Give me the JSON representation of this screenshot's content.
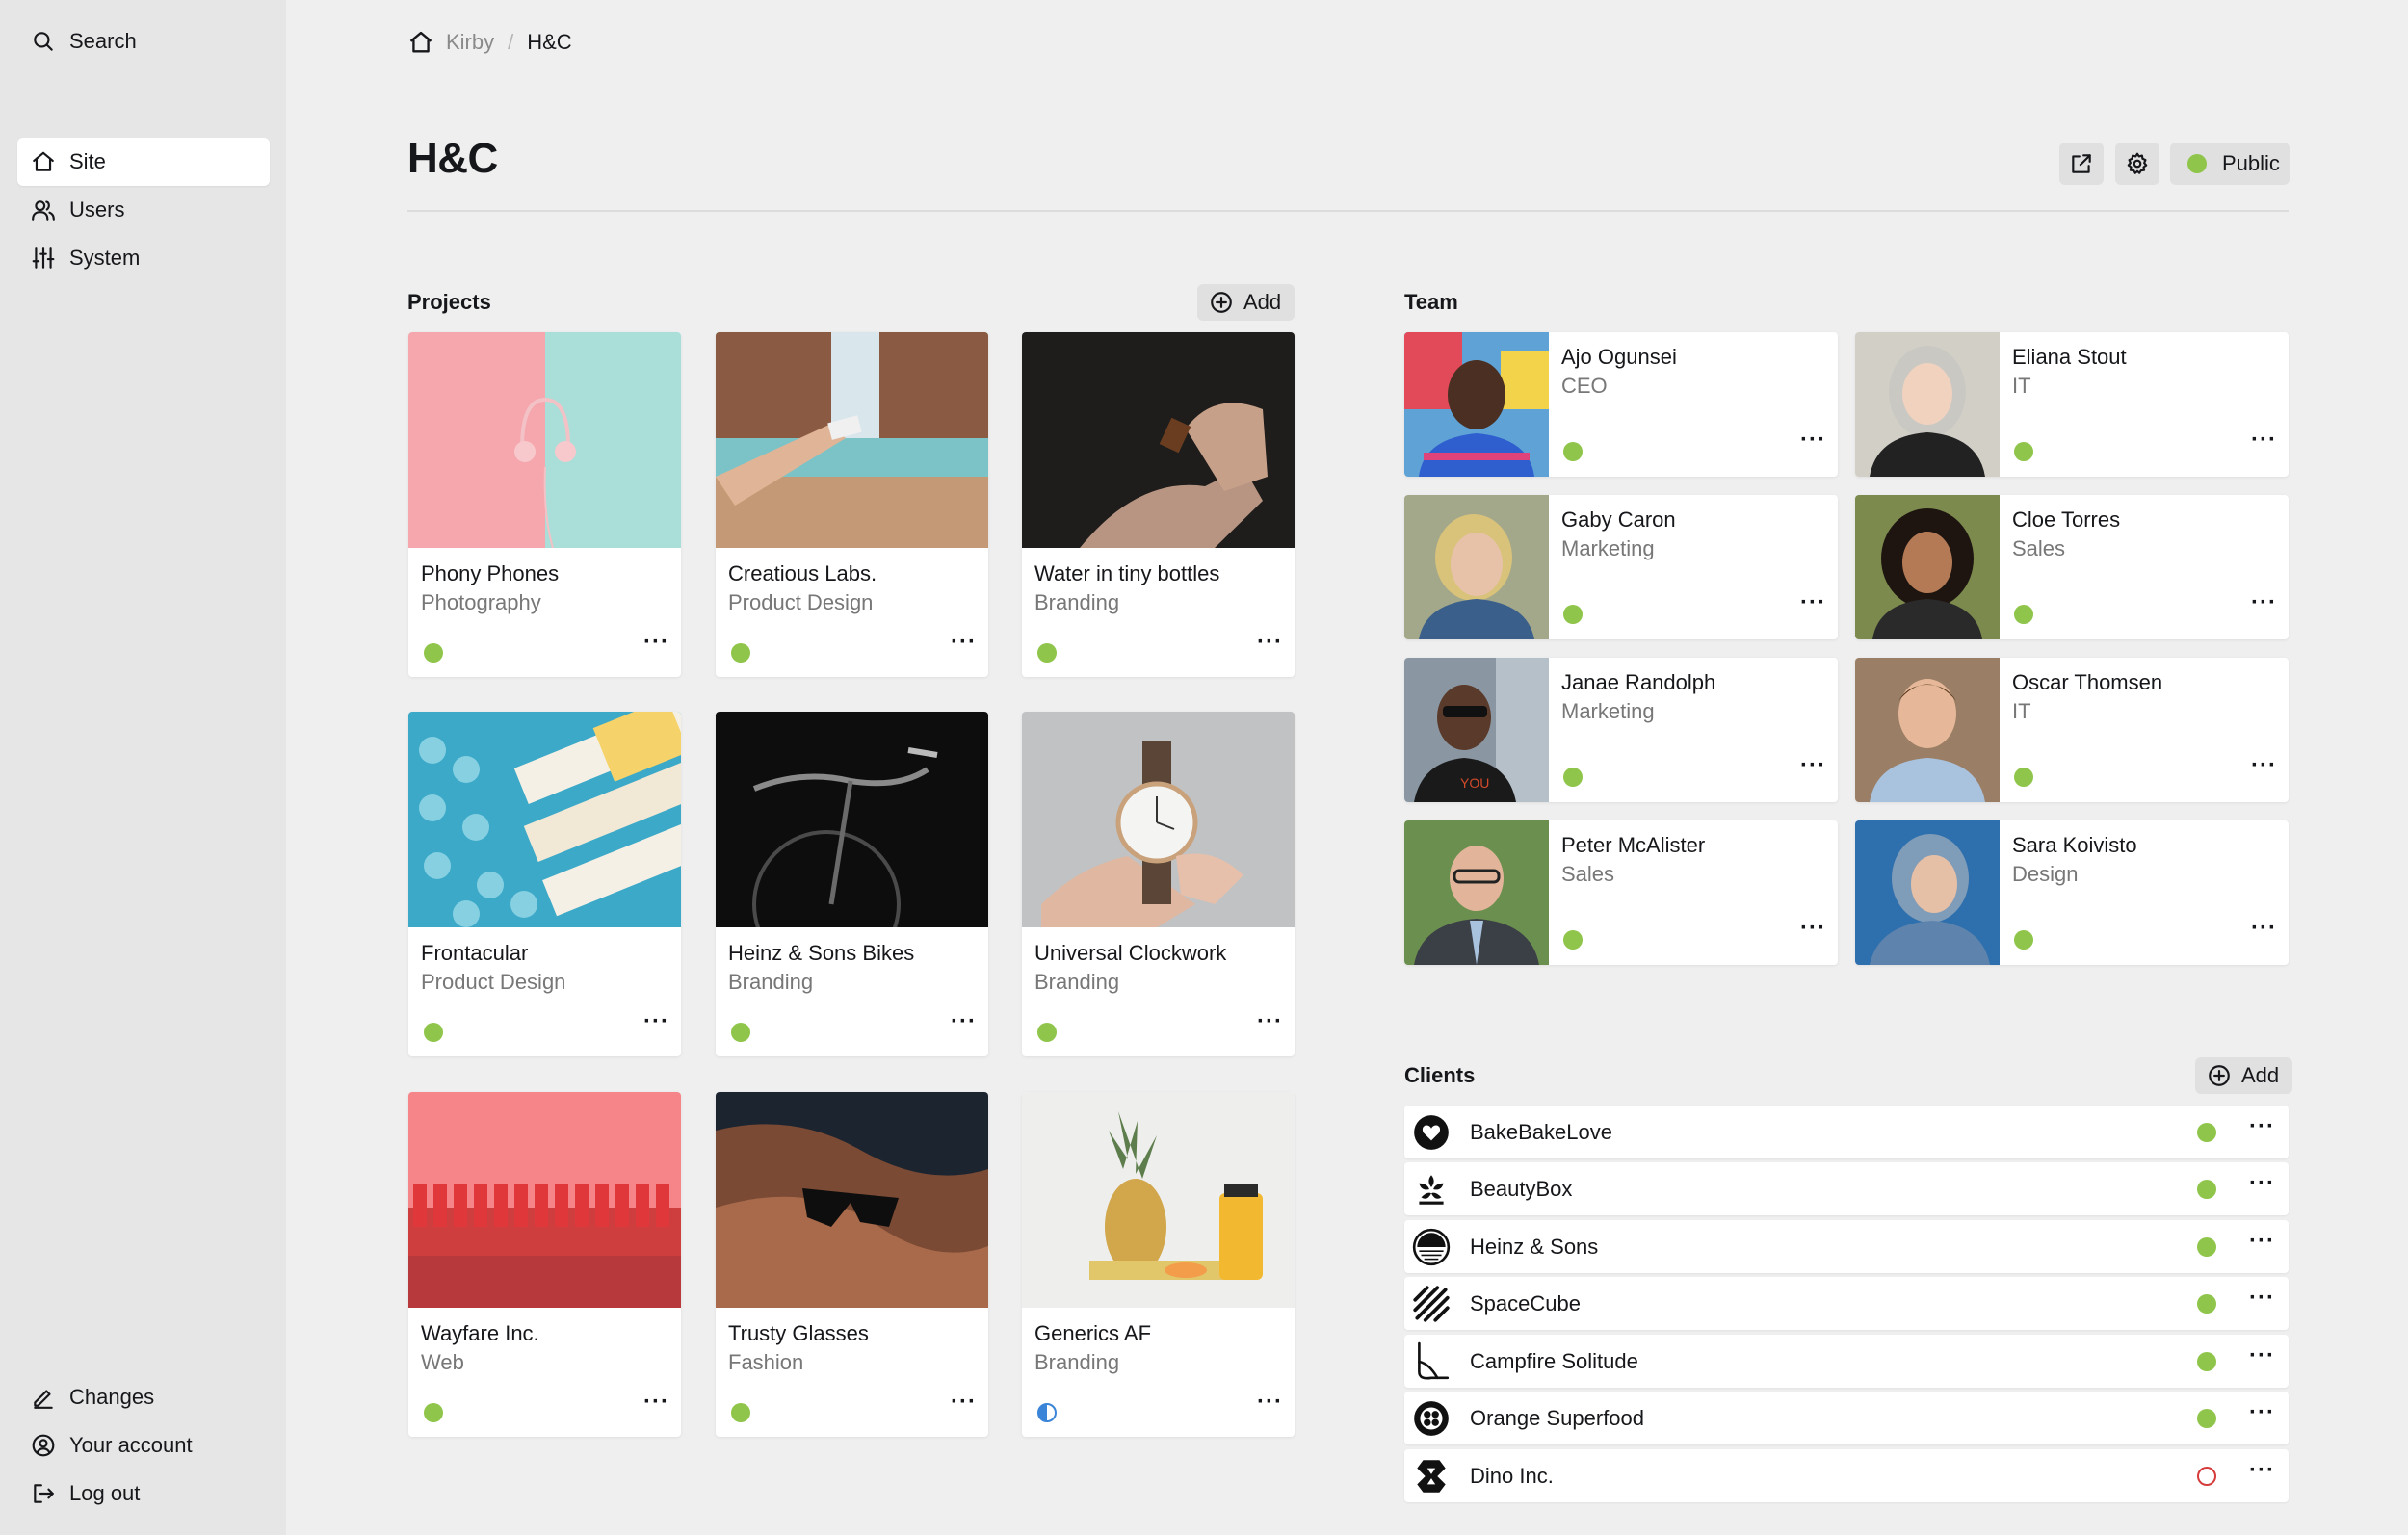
{
  "sidebar": {
    "search_label": "Search",
    "nav": [
      {
        "label": "Site",
        "icon": "home-icon"
      },
      {
        "label": "Users",
        "icon": "users-icon"
      },
      {
        "label": "System",
        "icon": "sliders-icon"
      }
    ],
    "bottom": [
      {
        "label": "Changes",
        "icon": "pencil-icon"
      },
      {
        "label": "Your account",
        "icon": "account-icon"
      },
      {
        "label": "Log out",
        "icon": "logout-icon"
      }
    ]
  },
  "breadcrumb": {
    "root": "Kirby",
    "separator": "/",
    "current": "H&C"
  },
  "page": {
    "title": "H&C",
    "status_label": "Public",
    "status": "published"
  },
  "projects": {
    "label": "Projects",
    "add_label": "Add",
    "items": [
      {
        "title": "Phony Phones",
        "category": "Photography",
        "status": "published"
      },
      {
        "title": "Creatious Labs.",
        "category": "Product Design",
        "status": "published"
      },
      {
        "title": "Water in tiny bottles",
        "category": "Branding",
        "status": "published"
      },
      {
        "title": "Frontacular",
        "category": "Product Design",
        "status": "published"
      },
      {
        "title": "Heinz & Sons Bikes",
        "category": "Branding",
        "status": "published"
      },
      {
        "title": "Universal Clockwork",
        "category": "Branding",
        "status": "published"
      },
      {
        "title": "Wayfare Inc.",
        "category": "Web",
        "status": "published"
      },
      {
        "title": "Trusty Glasses",
        "category": "Fashion",
        "status": "published"
      },
      {
        "title": "Generics AF",
        "category": "Branding",
        "status": "unlisted"
      }
    ]
  },
  "team": {
    "label": "Team",
    "members": [
      {
        "name": "Ajo Ogunsei",
        "role": "CEO",
        "status": "published"
      },
      {
        "name": "Eliana Stout",
        "role": "IT",
        "status": "published"
      },
      {
        "name": "Gaby Caron",
        "role": "Marketing",
        "status": "published"
      },
      {
        "name": "Cloe Torres",
        "role": "Sales",
        "status": "published"
      },
      {
        "name": "Janae Randolph",
        "role": "Marketing",
        "status": "published"
      },
      {
        "name": "Oscar Thomsen",
        "role": "IT",
        "status": "published"
      },
      {
        "name": "Peter McAlister",
        "role": "Sales",
        "status": "published"
      },
      {
        "name": "Sara Koivisto",
        "role": "Design",
        "status": "published"
      }
    ]
  },
  "clients": {
    "label": "Clients",
    "add_label": "Add",
    "items": [
      {
        "name": "BakeBakeLove",
        "status": "published"
      },
      {
        "name": "BeautyBox",
        "status": "published"
      },
      {
        "name": "Heinz & Sons",
        "status": "published"
      },
      {
        "name": "SpaceCube",
        "status": "published"
      },
      {
        "name": "Campfire Solitude",
        "status": "published"
      },
      {
        "name": "Orange Superfood",
        "status": "published"
      },
      {
        "name": "Dino Inc.",
        "status": "draft"
      }
    ]
  },
  "more_glyph": "···",
  "colors": {
    "published": "#8fc54a",
    "draft": "#d63b3b",
    "unlisted": "#3a85d8",
    "sidebar": "#e6e6e6",
    "background": "#efefef"
  }
}
